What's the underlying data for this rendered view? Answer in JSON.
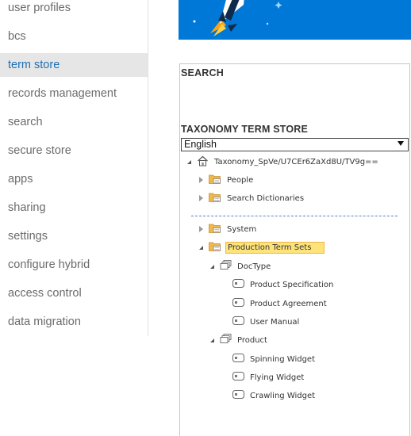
{
  "nav": {
    "items": [
      {
        "label": "user profiles",
        "active": false
      },
      {
        "label": "bcs",
        "active": false
      },
      {
        "label": "term store",
        "active": true
      },
      {
        "label": "records management",
        "active": false
      },
      {
        "label": "search",
        "active": false
      },
      {
        "label": "secure store",
        "active": false
      },
      {
        "label": "apps",
        "active": false
      },
      {
        "label": "sharing",
        "active": false
      },
      {
        "label": "settings",
        "active": false
      },
      {
        "label": "configure hybrid",
        "active": false
      },
      {
        "label": "access control",
        "active": false
      },
      {
        "label": "data migration",
        "active": false
      }
    ]
  },
  "term_store": {
    "search_title": "SEARCH",
    "taxonomy_title": "TAXONOMY TERM STORE",
    "language": "English",
    "tree": {
      "root": {
        "label": "Taxonomy_SpVe/U7CEr6ZaXd8U/TV9g==",
        "icon": "house-icon",
        "expanded": true
      },
      "groups": [
        {
          "label": "People",
          "icon": "folder-icon",
          "expanded": false
        },
        {
          "label": "Search Dictionaries",
          "icon": "folder-icon",
          "expanded": false
        },
        {
          "label": "System",
          "icon": "folder-icon",
          "expanded": false
        },
        {
          "label": "Production Term Sets",
          "icon": "folder-icon",
          "expanded": true,
          "selected": true,
          "term_sets": [
            {
              "label": "DocType",
              "icon": "term-set-icon",
              "expanded": true,
              "terms": [
                "Product Specification",
                "Product Agreement",
                "User Manual"
              ]
            },
            {
              "label": "Product",
              "icon": "term-set-icon",
              "expanded": true,
              "terms": [
                "Spinning Widget",
                "Flying Widget",
                "Crawling Widget"
              ]
            }
          ]
        }
      ]
    }
  },
  "colors": {
    "accent": "#1e6fb2",
    "hero": "#0078d7",
    "selected_bg": "#fde37a",
    "selected_border": "#f0b64a",
    "folder": "#f1b84b"
  }
}
